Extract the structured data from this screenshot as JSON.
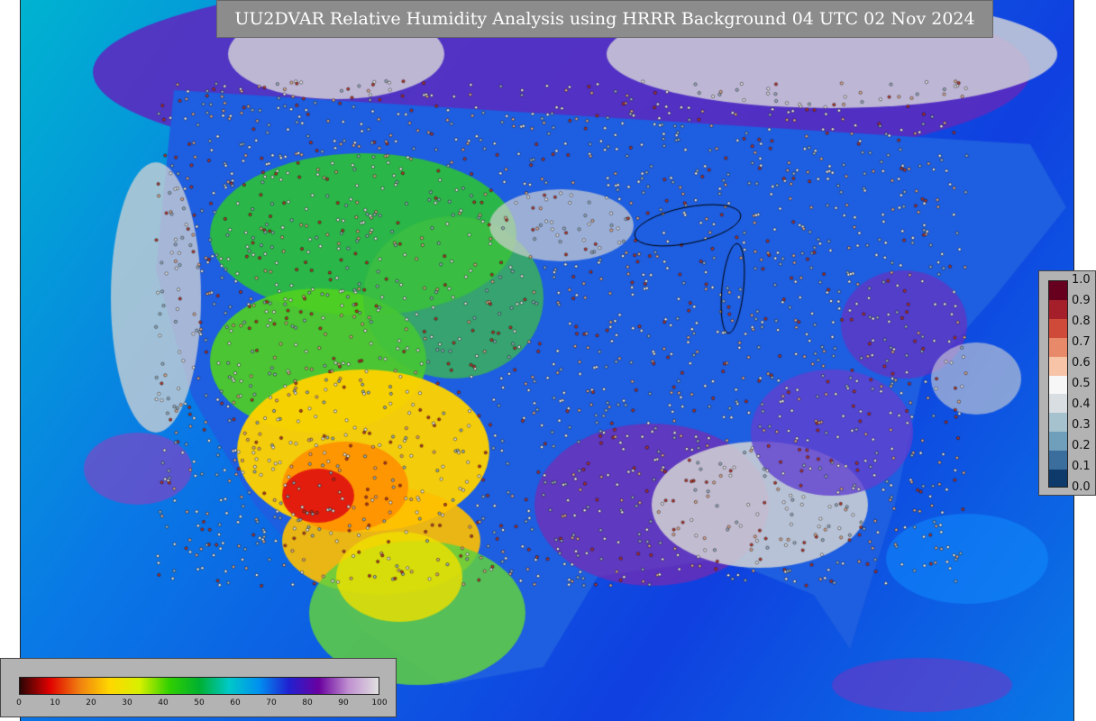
{
  "title": "UU2DVAR Relative Humidity Analysis using HRRR Background 04 UTC 02 Nov 2024",
  "rh_colorbar": {
    "ticks": [
      "0",
      "10",
      "20",
      "30",
      "40",
      "50",
      "60",
      "70",
      "80",
      "90",
      "100"
    ],
    "colors": [
      "#2a0505",
      "#e00000",
      "#f08010",
      "#ffd700",
      "#d8f000",
      "#30d000",
      "#00b030",
      "#00c8c8",
      "#0090f0",
      "#2020d0",
      "#6a00a0",
      "#c090d0",
      "#e0e0e0"
    ]
  },
  "innovation_colorbar": {
    "ticks": [
      "1.0",
      "0.9",
      "0.8",
      "0.7",
      "0.6",
      "0.5",
      "0.4",
      "0.3",
      "0.2",
      "0.1",
      "0.0"
    ],
    "colors": [
      "#67001f",
      "#a51f2a",
      "#d04a3a",
      "#e88a6a",
      "#f7c4a8",
      "#f7f7f7",
      "#d8dee2",
      "#a7c2cf",
      "#6f9fbb",
      "#3b6e9c",
      "#0d3a6b"
    ]
  },
  "map": {
    "colors": {
      "ocean": "#0a78e6",
      "humid": "#3a1fd0",
      "saturated": "#d4d4d4",
      "dry": "#ffd200",
      "very_dry": "#e01010",
      "moderate": "#2ec62e",
      "boundary": "#000000"
    }
  }
}
